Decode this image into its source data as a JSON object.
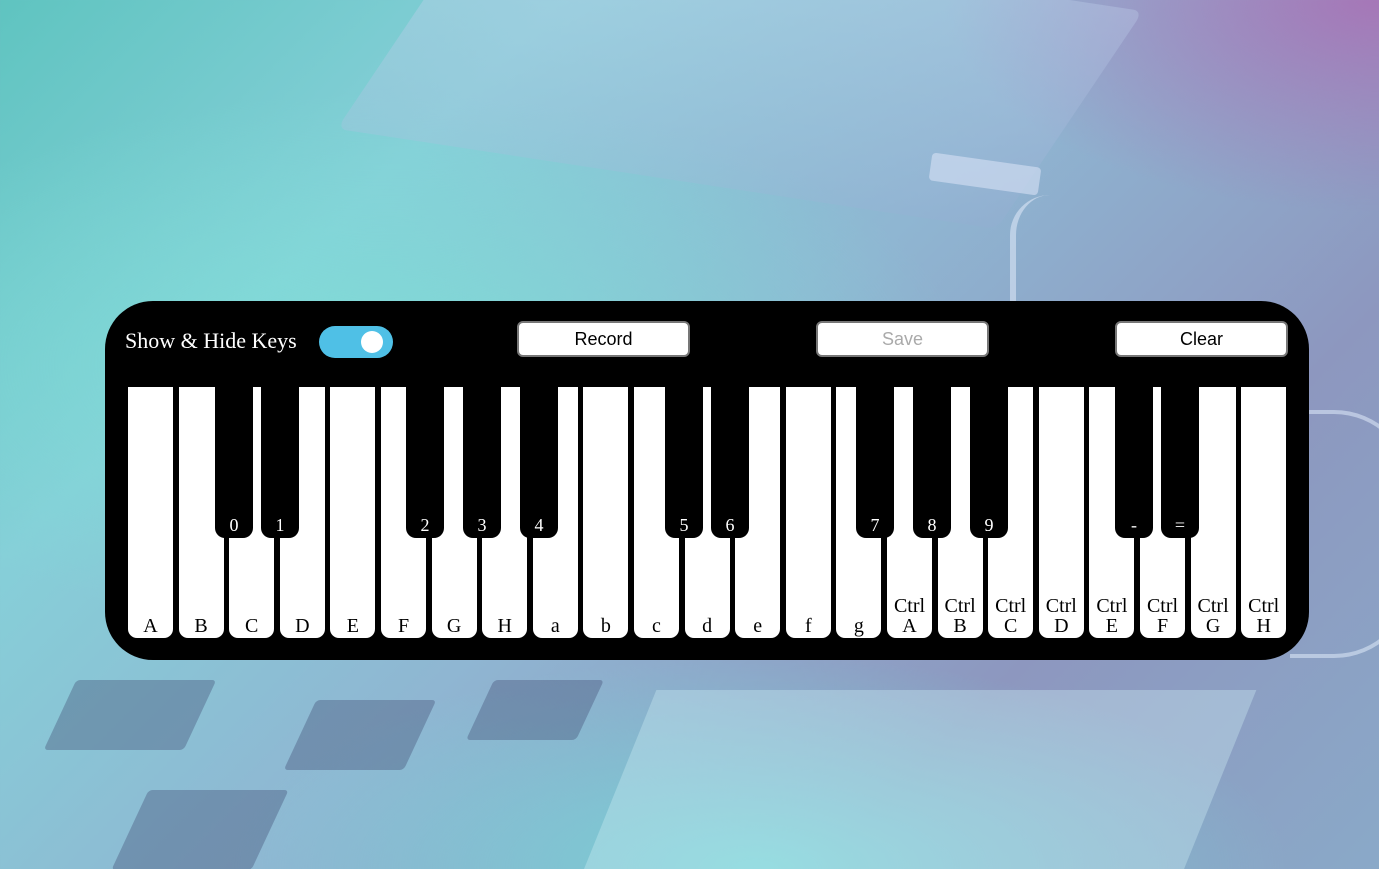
{
  "toolbar": {
    "toggle_label": "Show & Hide Keys",
    "toggle_on": true,
    "record_label": "Record",
    "save_label": "Save",
    "clear_label": "Clear"
  },
  "white_keys": [
    {
      "line1": "",
      "line2": "A"
    },
    {
      "line1": "",
      "line2": "B"
    },
    {
      "line1": "",
      "line2": "C"
    },
    {
      "line1": "",
      "line2": "D"
    },
    {
      "line1": "",
      "line2": "E"
    },
    {
      "line1": "",
      "line2": "F"
    },
    {
      "line1": "",
      "line2": "G"
    },
    {
      "line1": "",
      "line2": "H"
    },
    {
      "line1": "",
      "line2": "a"
    },
    {
      "line1": "",
      "line2": "b"
    },
    {
      "line1": "",
      "line2": "c"
    },
    {
      "line1": "",
      "line2": "d"
    },
    {
      "line1": "",
      "line2": "e"
    },
    {
      "line1": "",
      "line2": "f"
    },
    {
      "line1": "",
      "line2": "g"
    },
    {
      "line1": "Ctrl",
      "line2": "A"
    },
    {
      "line1": "Ctrl",
      "line2": "B"
    },
    {
      "line1": "Ctrl",
      "line2": "C"
    },
    {
      "line1": "Ctrl",
      "line2": "D"
    },
    {
      "line1": "Ctrl",
      "line2": "E"
    },
    {
      "line1": "Ctrl",
      "line2": "F"
    },
    {
      "line1": "Ctrl",
      "line2": "G"
    },
    {
      "line1": "Ctrl",
      "line2": "H"
    }
  ],
  "black_keys": [
    {
      "label": "0"
    },
    {
      "label": "1"
    },
    {
      "label": "2"
    },
    {
      "label": "3"
    },
    {
      "label": "4"
    },
    {
      "label": "5"
    },
    {
      "label": "6"
    },
    {
      "label": "7"
    },
    {
      "label": "8"
    },
    {
      "label": "9"
    },
    {
      "label": "-"
    },
    {
      "label": "="
    }
  ]
}
